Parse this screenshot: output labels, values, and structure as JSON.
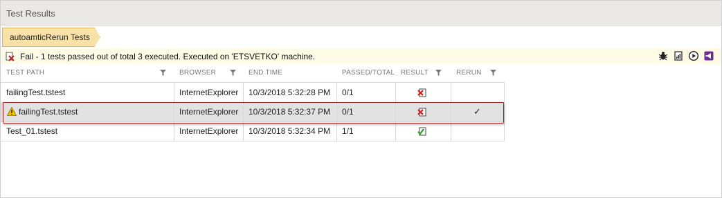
{
  "panel": {
    "title": "Test Results"
  },
  "breadcrumb": {
    "label": "autoamticRerun Tests"
  },
  "status": {
    "text": "Fail - 1 tests passed out of total 3 executed. Executed on 'ETSVETKO' machine.",
    "icon": "fail-icon",
    "toolbar": [
      "bug-icon",
      "report-icon",
      "play-icon",
      "visual-studio-icon"
    ]
  },
  "columns": {
    "test_path": "TEST PATH",
    "browser": "BROWSER",
    "end_time": "END TIME",
    "passed_total": "PASSED/TOTAL",
    "result": "RESULT",
    "rerun": "RERUN"
  },
  "rows": [
    {
      "test_path": "failingTest.tstest",
      "browser": "InternetExplorer",
      "end_time": "10/3/2018 5:32:28 PM",
      "passed_total": "0/1",
      "result": "fail",
      "rerun": ""
    },
    {
      "test_path": "failingTest.tstest",
      "browser": "InternetExplorer",
      "end_time": "10/3/2018 5:32:37 PM",
      "passed_total": "0/1",
      "result": "fail",
      "rerun": "✓",
      "warning": true
    },
    {
      "test_path": "Test_01.tstest",
      "browser": "InternetExplorer",
      "end_time": "10/3/2018 5:32:34 PM",
      "passed_total": "1/1",
      "result": "pass",
      "rerun": ""
    }
  ],
  "colors": {
    "fail": "#cc1f1f",
    "pass": "#2f9a2f",
    "warning": "#f2c200",
    "highlight_border": "#9c1c1c",
    "breadcrumb_fill": "#f8e2a8"
  }
}
